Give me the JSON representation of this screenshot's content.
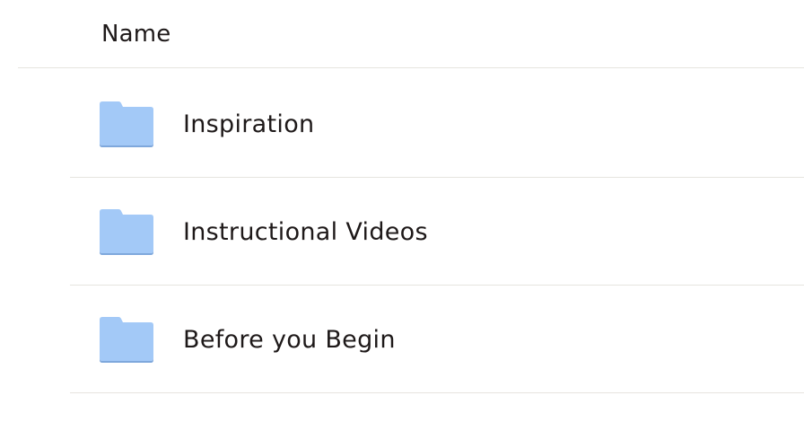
{
  "table": {
    "column_header": "Name",
    "rows": [
      {
        "name": "Inspiration",
        "icon": "folder-icon"
      },
      {
        "name": "Instructional Videos",
        "icon": "folder-icon"
      },
      {
        "name": "Before you Begin",
        "icon": "folder-icon"
      }
    ]
  },
  "colors": {
    "folder": "#a3c9f7",
    "folder_shadow": "#7fa8dc",
    "divider": "#e6e4df",
    "text": "#1e1919"
  }
}
